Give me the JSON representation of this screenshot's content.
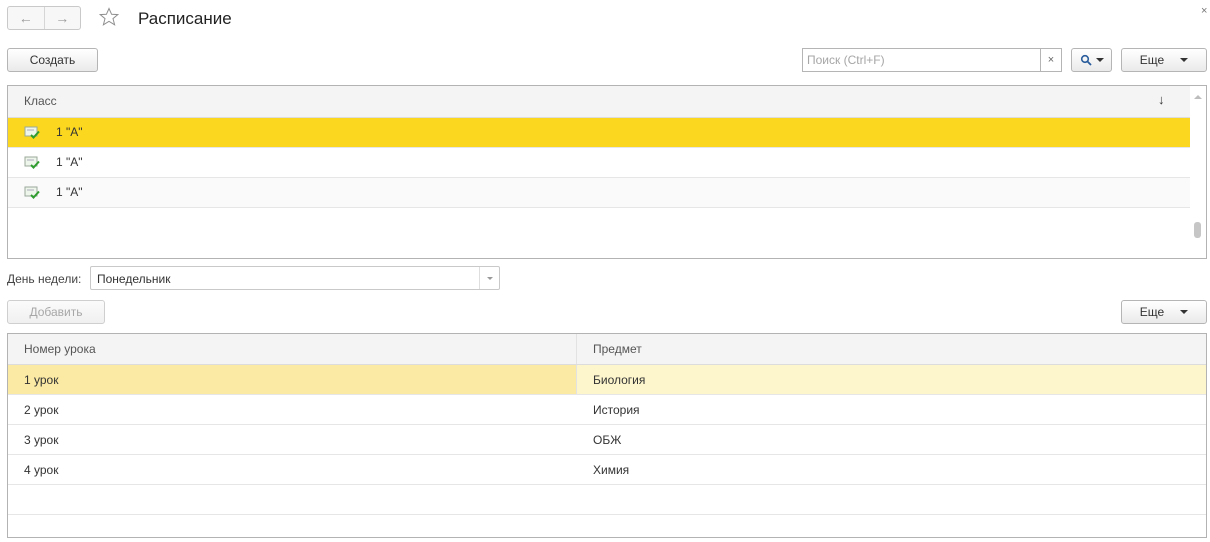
{
  "window": {
    "title": "Расписание",
    "close_glyph": "×"
  },
  "toolbar": {
    "create_label": "Создать",
    "search_placeholder": "Поиск (Ctrl+F)",
    "search_clear": "×",
    "more_label": "Еще"
  },
  "classes": {
    "column_header": "Класс",
    "sort_indicator": "↓",
    "rows": [
      {
        "label": "1 \"А\"",
        "selected": true
      },
      {
        "label": "1 \"А\"",
        "selected": false
      },
      {
        "label": "1 \"А\"",
        "selected": false
      }
    ]
  },
  "day": {
    "label": "День недели:",
    "value": "Понедельник"
  },
  "lessons_toolbar": {
    "add_label": "Добавить",
    "more_label": "Еще"
  },
  "lessons": {
    "headers": [
      "Номер урока",
      "Предмет"
    ],
    "rows": [
      {
        "number": "1 урок",
        "subject": "Биология",
        "selected": true
      },
      {
        "number": "2 урок",
        "subject": "История",
        "selected": false
      },
      {
        "number": "3 урок",
        "subject": "ОБЖ",
        "selected": false
      },
      {
        "number": "4 урок",
        "subject": "Химия",
        "selected": false
      }
    ]
  },
  "colors": {
    "selected_row": "#fbd81f",
    "selected_cell_light": "#faeaa3"
  }
}
